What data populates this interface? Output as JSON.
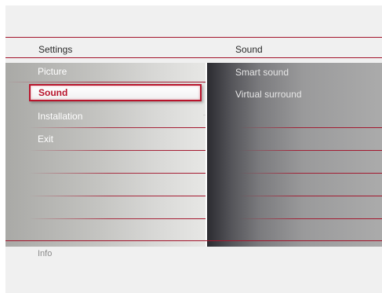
{
  "menu": {
    "left_title": "Settings",
    "right_title": "Sound",
    "left_items": [
      "Picture",
      "Sound",
      "Installation",
      "Exit"
    ],
    "selected_item": "Sound",
    "right_items": [
      "Smart sound",
      "Virtual surround"
    ],
    "info_label": "Info"
  },
  "colors": {
    "accent": "#a3152c",
    "highlight_text": "#b9142c"
  }
}
